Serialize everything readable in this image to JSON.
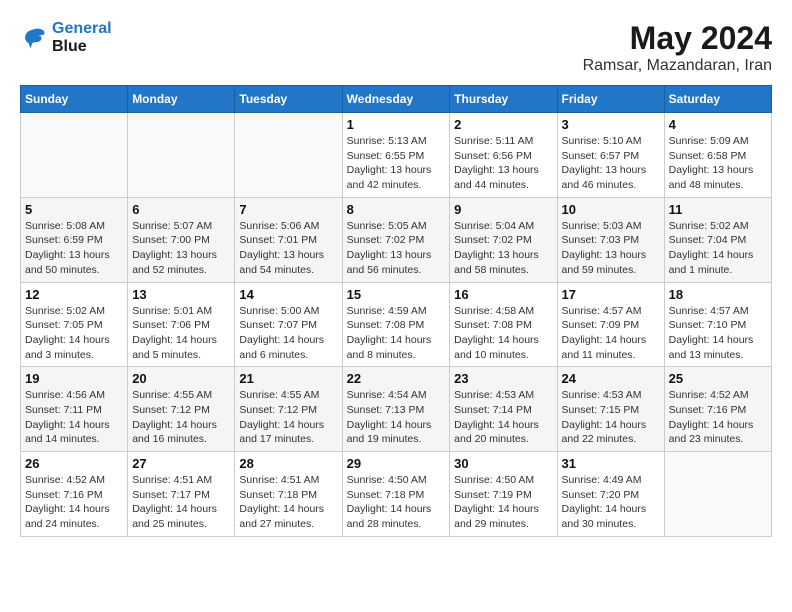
{
  "header": {
    "logo_line1": "General",
    "logo_line2": "Blue",
    "month_year": "May 2024",
    "location": "Ramsar, Mazandaran, Iran"
  },
  "weekdays": [
    "Sunday",
    "Monday",
    "Tuesday",
    "Wednesday",
    "Thursday",
    "Friday",
    "Saturday"
  ],
  "weeks": [
    [
      {
        "day": "",
        "detail": ""
      },
      {
        "day": "",
        "detail": ""
      },
      {
        "day": "",
        "detail": ""
      },
      {
        "day": "1",
        "detail": "Sunrise: 5:13 AM\nSunset: 6:55 PM\nDaylight: 13 hours\nand 42 minutes."
      },
      {
        "day": "2",
        "detail": "Sunrise: 5:11 AM\nSunset: 6:56 PM\nDaylight: 13 hours\nand 44 minutes."
      },
      {
        "day": "3",
        "detail": "Sunrise: 5:10 AM\nSunset: 6:57 PM\nDaylight: 13 hours\nand 46 minutes."
      },
      {
        "day": "4",
        "detail": "Sunrise: 5:09 AM\nSunset: 6:58 PM\nDaylight: 13 hours\nand 48 minutes."
      }
    ],
    [
      {
        "day": "5",
        "detail": "Sunrise: 5:08 AM\nSunset: 6:59 PM\nDaylight: 13 hours\nand 50 minutes."
      },
      {
        "day": "6",
        "detail": "Sunrise: 5:07 AM\nSunset: 7:00 PM\nDaylight: 13 hours\nand 52 minutes."
      },
      {
        "day": "7",
        "detail": "Sunrise: 5:06 AM\nSunset: 7:01 PM\nDaylight: 13 hours\nand 54 minutes."
      },
      {
        "day": "8",
        "detail": "Sunrise: 5:05 AM\nSunset: 7:02 PM\nDaylight: 13 hours\nand 56 minutes."
      },
      {
        "day": "9",
        "detail": "Sunrise: 5:04 AM\nSunset: 7:02 PM\nDaylight: 13 hours\nand 58 minutes."
      },
      {
        "day": "10",
        "detail": "Sunrise: 5:03 AM\nSunset: 7:03 PM\nDaylight: 13 hours\nand 59 minutes."
      },
      {
        "day": "11",
        "detail": "Sunrise: 5:02 AM\nSunset: 7:04 PM\nDaylight: 14 hours\nand 1 minute."
      }
    ],
    [
      {
        "day": "12",
        "detail": "Sunrise: 5:02 AM\nSunset: 7:05 PM\nDaylight: 14 hours\nand 3 minutes."
      },
      {
        "day": "13",
        "detail": "Sunrise: 5:01 AM\nSunset: 7:06 PM\nDaylight: 14 hours\nand 5 minutes."
      },
      {
        "day": "14",
        "detail": "Sunrise: 5:00 AM\nSunset: 7:07 PM\nDaylight: 14 hours\nand 6 minutes."
      },
      {
        "day": "15",
        "detail": "Sunrise: 4:59 AM\nSunset: 7:08 PM\nDaylight: 14 hours\nand 8 minutes."
      },
      {
        "day": "16",
        "detail": "Sunrise: 4:58 AM\nSunset: 7:08 PM\nDaylight: 14 hours\nand 10 minutes."
      },
      {
        "day": "17",
        "detail": "Sunrise: 4:57 AM\nSunset: 7:09 PM\nDaylight: 14 hours\nand 11 minutes."
      },
      {
        "day": "18",
        "detail": "Sunrise: 4:57 AM\nSunset: 7:10 PM\nDaylight: 14 hours\nand 13 minutes."
      }
    ],
    [
      {
        "day": "19",
        "detail": "Sunrise: 4:56 AM\nSunset: 7:11 PM\nDaylight: 14 hours\nand 14 minutes."
      },
      {
        "day": "20",
        "detail": "Sunrise: 4:55 AM\nSunset: 7:12 PM\nDaylight: 14 hours\nand 16 minutes."
      },
      {
        "day": "21",
        "detail": "Sunrise: 4:55 AM\nSunset: 7:12 PM\nDaylight: 14 hours\nand 17 minutes."
      },
      {
        "day": "22",
        "detail": "Sunrise: 4:54 AM\nSunset: 7:13 PM\nDaylight: 14 hours\nand 19 minutes."
      },
      {
        "day": "23",
        "detail": "Sunrise: 4:53 AM\nSunset: 7:14 PM\nDaylight: 14 hours\nand 20 minutes."
      },
      {
        "day": "24",
        "detail": "Sunrise: 4:53 AM\nSunset: 7:15 PM\nDaylight: 14 hours\nand 22 minutes."
      },
      {
        "day": "25",
        "detail": "Sunrise: 4:52 AM\nSunset: 7:16 PM\nDaylight: 14 hours\nand 23 minutes."
      }
    ],
    [
      {
        "day": "26",
        "detail": "Sunrise: 4:52 AM\nSunset: 7:16 PM\nDaylight: 14 hours\nand 24 minutes."
      },
      {
        "day": "27",
        "detail": "Sunrise: 4:51 AM\nSunset: 7:17 PM\nDaylight: 14 hours\nand 25 minutes."
      },
      {
        "day": "28",
        "detail": "Sunrise: 4:51 AM\nSunset: 7:18 PM\nDaylight: 14 hours\nand 27 minutes."
      },
      {
        "day": "29",
        "detail": "Sunrise: 4:50 AM\nSunset: 7:18 PM\nDaylight: 14 hours\nand 28 minutes."
      },
      {
        "day": "30",
        "detail": "Sunrise: 4:50 AM\nSunset: 7:19 PM\nDaylight: 14 hours\nand 29 minutes."
      },
      {
        "day": "31",
        "detail": "Sunrise: 4:49 AM\nSunset: 7:20 PM\nDaylight: 14 hours\nand 30 minutes."
      },
      {
        "day": "",
        "detail": ""
      }
    ]
  ]
}
